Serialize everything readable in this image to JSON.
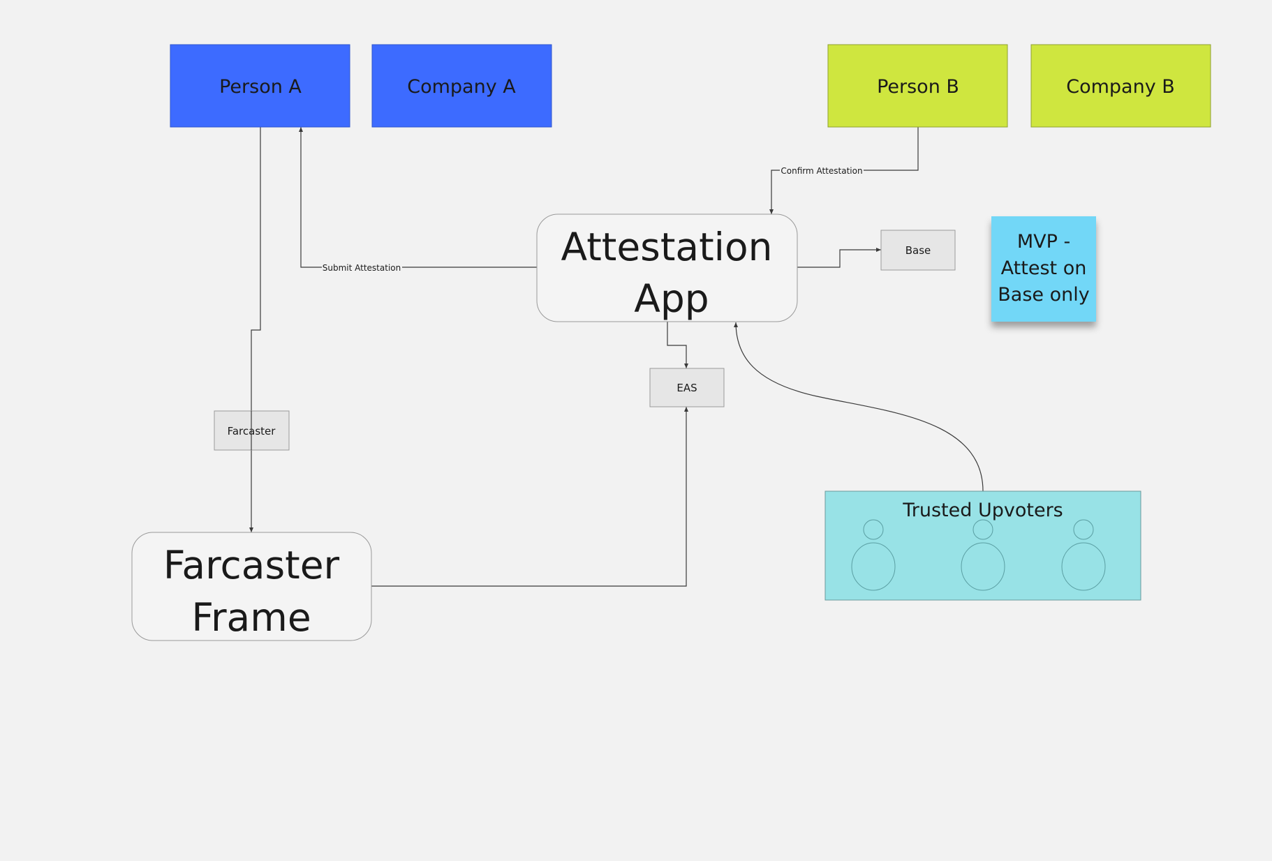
{
  "nodes": {
    "person_a": {
      "label": "Person A",
      "color": "#3d6bff"
    },
    "company_a": {
      "label": "Company A",
      "color": "#3d6bff"
    },
    "person_b": {
      "label": "Person B",
      "color": "#cfe63f"
    },
    "company_b": {
      "label": "Company B",
      "color": "#cfe63f"
    },
    "attestation_app": {
      "line1": "Attestation",
      "line2": "App"
    },
    "base": {
      "label": "Base"
    },
    "eas": {
      "label": "EAS"
    },
    "farcaster": {
      "label": "Farcaster"
    },
    "farcaster_frame": {
      "line1": "Farcaster",
      "line2": "Frame"
    },
    "trusted_upvoters": {
      "label": "Trusted Upvoters",
      "color": "#98e2e6",
      "people_count": 3
    }
  },
  "sticky_note": {
    "line1": "MVP -",
    "line2": "Attest on",
    "line3": "Base only",
    "color": "#72d7f7"
  },
  "connectors": {
    "submit_attestation": "Submit Attestation",
    "confirm_attestation": "Confirm Attestation"
  }
}
